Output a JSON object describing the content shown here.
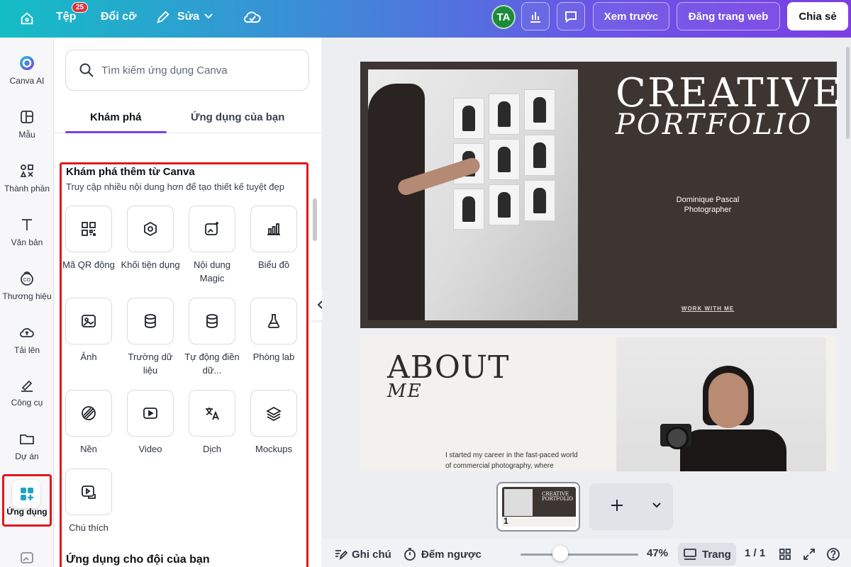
{
  "topbar": {
    "file_label": "Tệp",
    "file_badge": "25",
    "resize_label": "Đổi cỡ",
    "edit_label": "Sửa",
    "avatar_initials": "TA",
    "preview_label": "Xem trước",
    "publish_label": "Đăng trang web",
    "share_label": "Chia sẻ"
  },
  "rail": {
    "items": [
      {
        "label": "Canva AI",
        "icon": "canva-ai-icon"
      },
      {
        "label": "Mẫu",
        "icon": "template-icon"
      },
      {
        "label": "Thành phần",
        "icon": "elements-icon"
      },
      {
        "label": "Văn bản",
        "icon": "text-icon"
      },
      {
        "label": "Thương hiệu",
        "icon": "brand-icon"
      },
      {
        "label": "Tải lên",
        "icon": "upload-icon"
      },
      {
        "label": "Công cụ",
        "icon": "tools-icon"
      },
      {
        "label": "Dự án",
        "icon": "folder-icon"
      },
      {
        "label": "Ứng dụng",
        "icon": "apps-icon"
      }
    ]
  },
  "panel": {
    "search_placeholder": "Tìm kiếm ứng dụng Canva",
    "tabs": [
      {
        "label": "Khám phá",
        "active": true
      },
      {
        "label": "Ứng dụng của bạn",
        "active": false
      }
    ],
    "section_title": "Khám phá thêm từ Canva",
    "section_subtitle": "Truy cập nhiều nội dung hơn để tạo thiết kế tuyệt đẹp",
    "apps": [
      {
        "label": "Mã QR động",
        "icon": "qr-code-icon"
      },
      {
        "label": "Khối tiện dụng",
        "icon": "hexagon-icon"
      },
      {
        "label": "Nội dung Magic",
        "icon": "magic-image-icon"
      },
      {
        "label": "Biểu đồ",
        "icon": "bar-chart-icon"
      },
      {
        "label": "Ảnh",
        "icon": "image-icon"
      },
      {
        "label": "Trường dữ liệu",
        "icon": "database-icon"
      },
      {
        "label": "Tự động điền dữ...",
        "icon": "database-icon"
      },
      {
        "label": "Phòng lab",
        "icon": "flask-icon"
      },
      {
        "label": "Nền",
        "icon": "pattern-icon"
      },
      {
        "label": "Video",
        "icon": "video-icon"
      },
      {
        "label": "Dịch",
        "icon": "translate-icon"
      },
      {
        "label": "Mockups",
        "icon": "layers-icon"
      },
      {
        "label": "Chú thích",
        "icon": "caption-icon"
      }
    ],
    "section2_title": "Ứng dụng cho đội của bạn"
  },
  "slide1": {
    "title": "CREATIVE",
    "subtitle": "PORTFOLIO",
    "name": "Dominique Pascal",
    "role": "Photographer",
    "link": "WORK WITH ME"
  },
  "slide2": {
    "title": "ABOUT",
    "title2": "ME",
    "body": "I started my career in the fast-paced world of commercial photography, where"
  },
  "pages": {
    "thumb_number": "1",
    "thumb_title": "CREATIVE PORTFOLIO"
  },
  "bottombar": {
    "notes_label": "Ghi chú",
    "timer_label": "Đếm ngược",
    "zoom": "47%",
    "zoom_level": 0.47,
    "pages_label": "Trang",
    "page_count": "1 / 1"
  },
  "colors": {
    "accent": "#7c3fe4",
    "highlight": "#e0171f",
    "slide_dark": "#3d3532"
  }
}
